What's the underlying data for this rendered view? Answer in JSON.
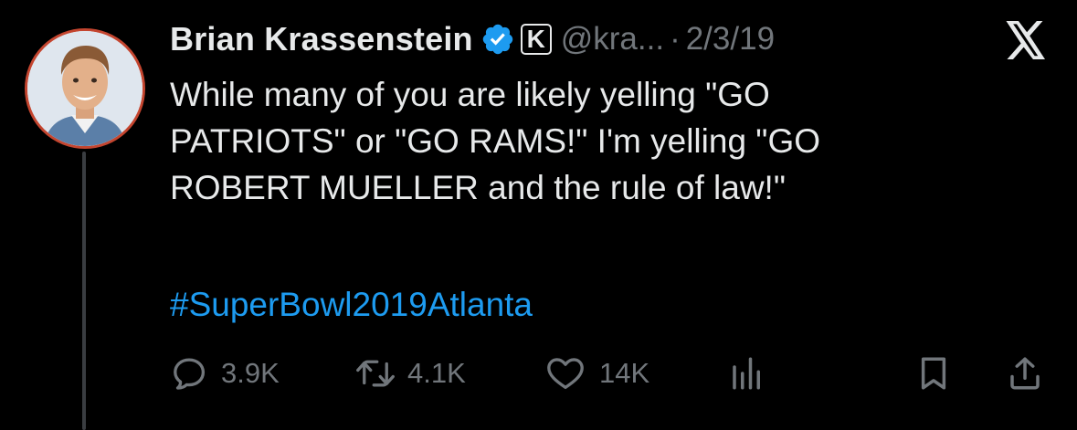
{
  "author": {
    "name": "Brian Krassenstein",
    "handle": "@kra...",
    "separator": "·",
    "date": "2/3/19",
    "affiliation_letter": "K"
  },
  "tweet": {
    "lines": [
      "While many of you are likely yelling \"GO",
      "PATRIOTS\" or \"GO RAMS!\" I'm yelling \"GO",
      "ROBERT MUELLER and the rule of law!\""
    ],
    "hashtag": "#SuperBowl2019Atlanta"
  },
  "actions": {
    "replies": "3.9K",
    "reposts": "4.1K",
    "likes": "14K"
  },
  "icons": {
    "verified": "verified-badge-icon",
    "affiliation": "affiliation-k-icon",
    "logo": "x-logo-icon",
    "reply": "reply-icon",
    "repost": "repost-icon",
    "like": "heart-icon",
    "views": "views-icon",
    "bookmark": "bookmark-icon",
    "share": "share-icon"
  },
  "colors": {
    "background": "#000000",
    "text": "#e7e9ea",
    "muted": "#71767b",
    "link": "#1d9bf0",
    "verified": "#1d9bf0",
    "avatar_ring": "#c4452f"
  }
}
